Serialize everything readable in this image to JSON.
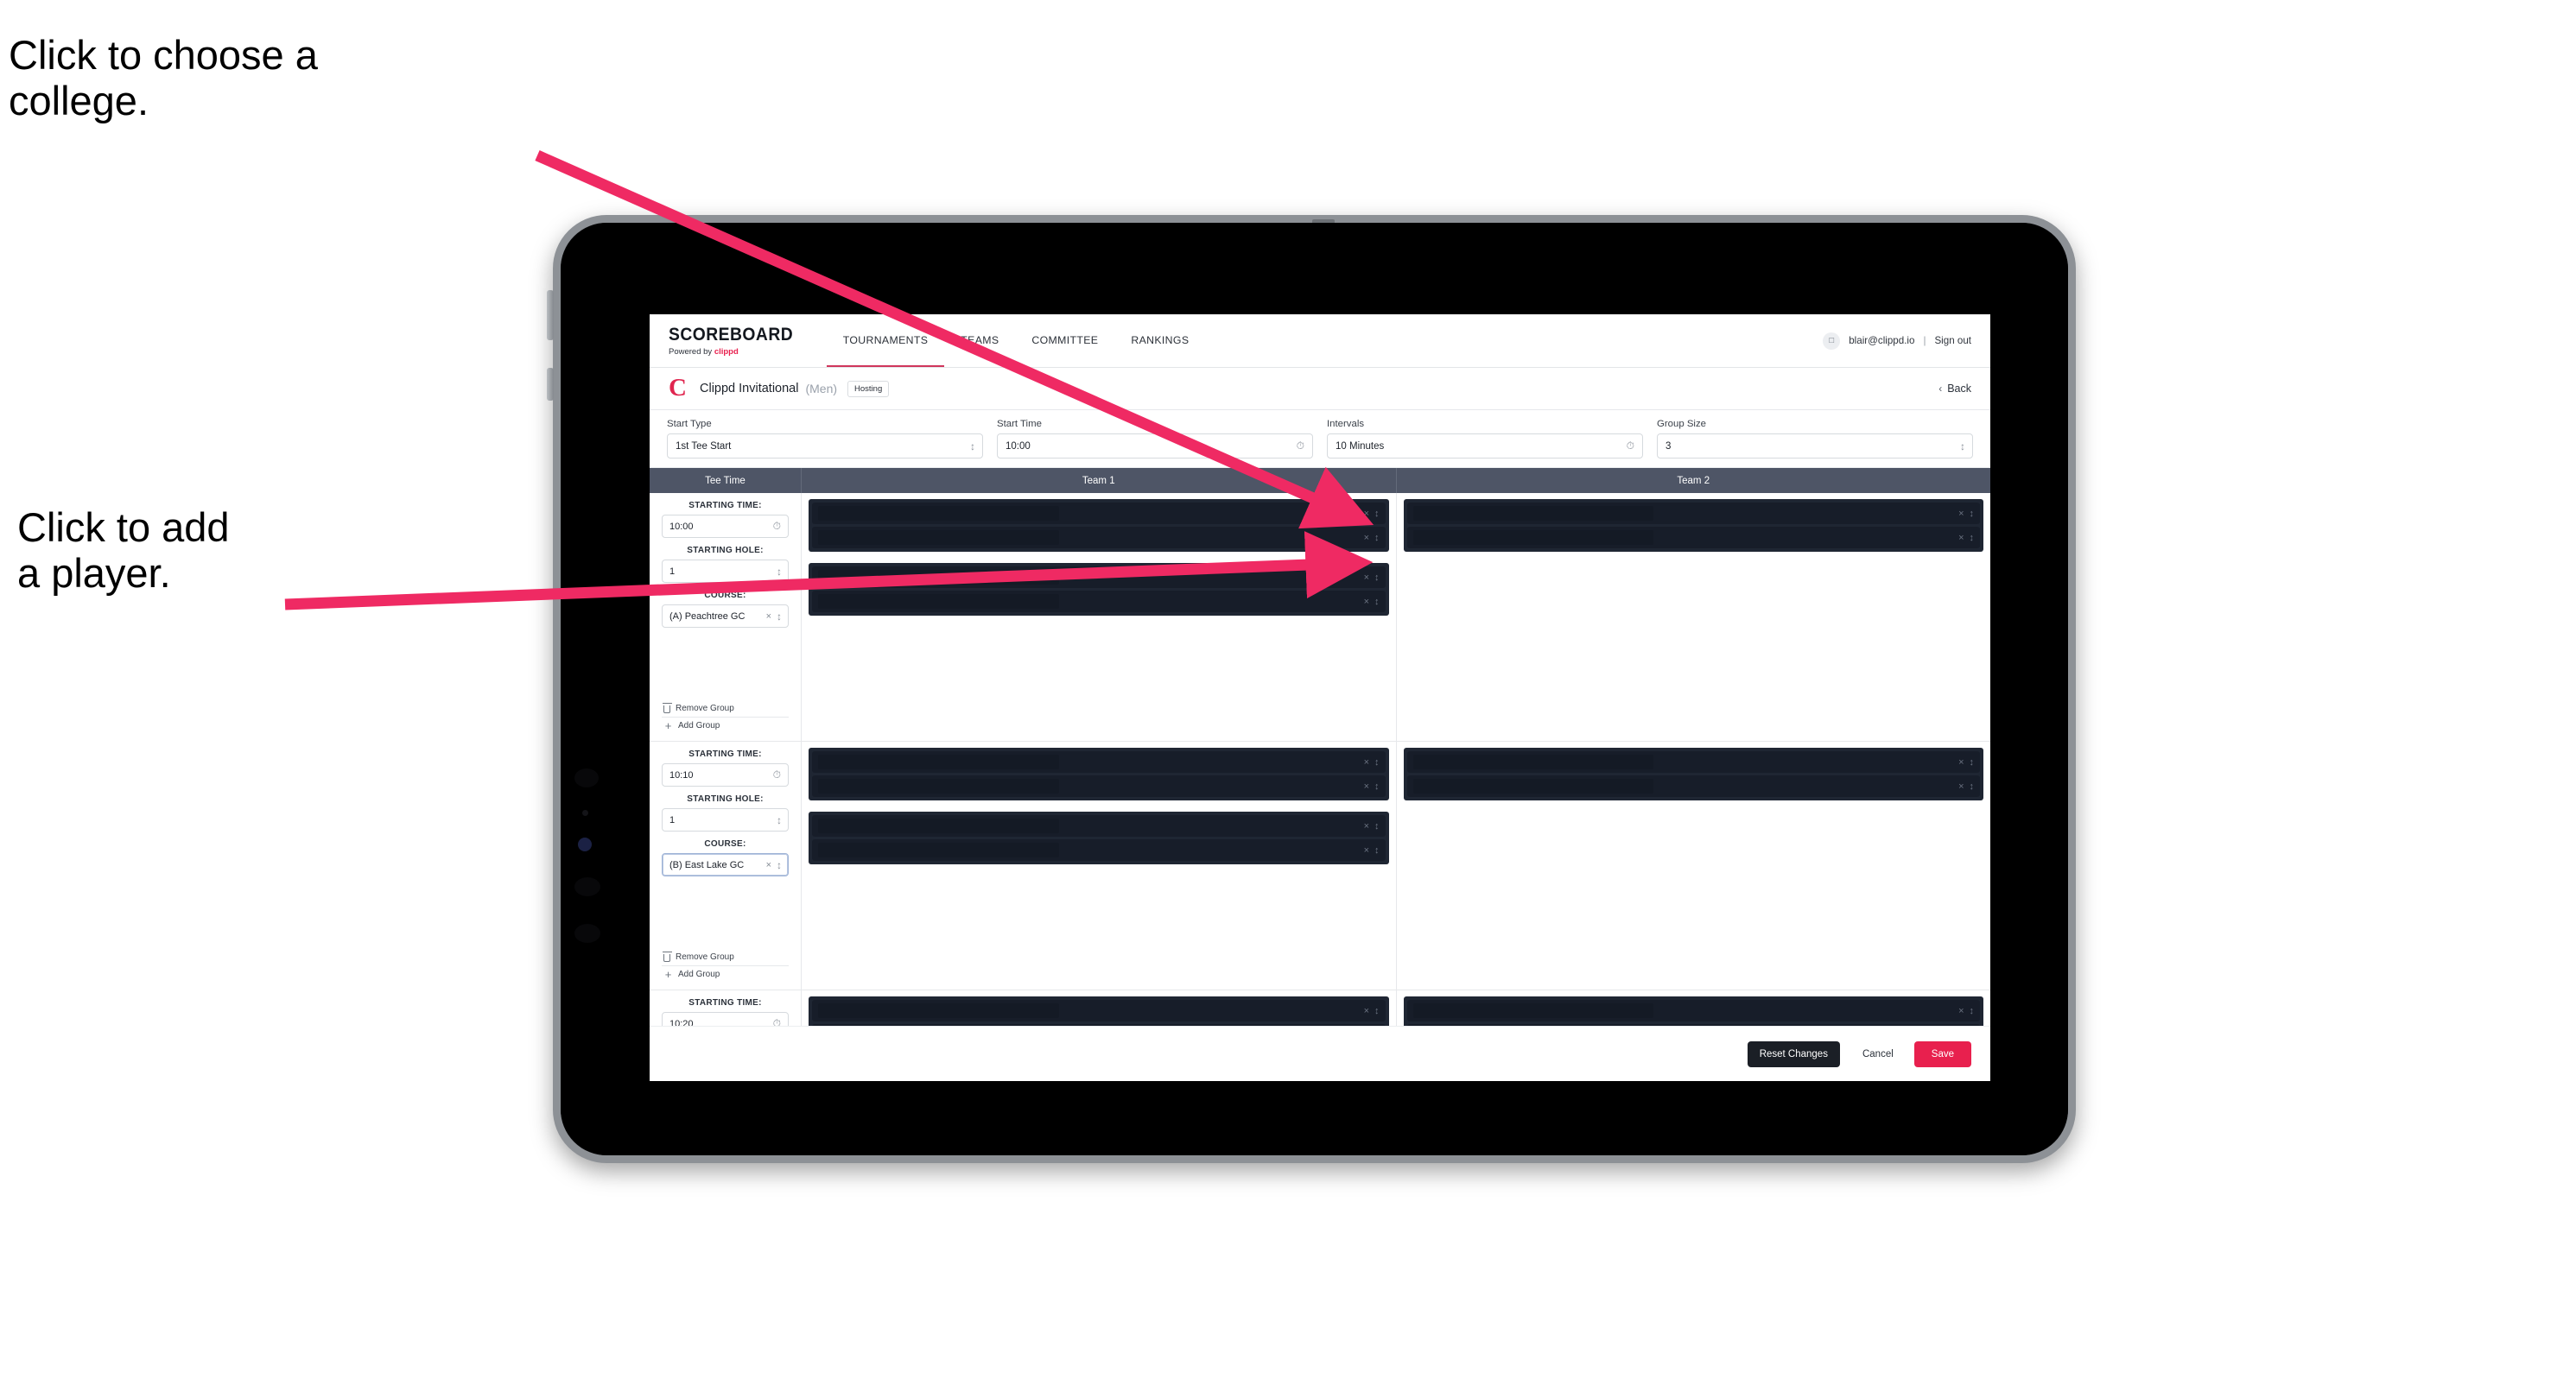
{
  "annotations": {
    "choose_college": "Click to choose a\ncollege.",
    "add_player": "Click to add\na player."
  },
  "colors": {
    "accent_pink": "#e8204e",
    "arrow_pink": "#ef2a63",
    "header_slate": "#4e5566",
    "panel_dark": "#1f2633",
    "slot_dark": "#171d29"
  },
  "topnav": {
    "brand_word": "SCOREBOARD",
    "brand_sub_prefix": "Powered by ",
    "brand_sub_name": "clippd",
    "items": [
      {
        "label": "TOURNAMENTS",
        "active": true
      },
      {
        "label": "TEAMS",
        "active": false
      },
      {
        "label": "COMMITTEE",
        "active": false
      },
      {
        "label": "RANKINGS",
        "active": false
      }
    ],
    "user_email": "blair@clippd.io",
    "divider": "|",
    "sign_out": "Sign out"
  },
  "tournament_bar": {
    "logo_letter": "C",
    "name": "Clippd Invitational",
    "gender": "(Men)",
    "badge": "Hosting",
    "back_chevron": "‹",
    "back_label": "Back"
  },
  "controls": [
    {
      "label": "Start Type",
      "value": "1st Tee Start",
      "adornment": "stepper"
    },
    {
      "label": "Start Time",
      "value": "10:00",
      "adornment": "clock"
    },
    {
      "label": "Intervals",
      "value": "10 Minutes",
      "adornment": "clock"
    },
    {
      "label": "Group Size",
      "value": "3",
      "adornment": "stepper"
    }
  ],
  "table": {
    "headers": [
      "Tee Time",
      "Team 1",
      "Team 2"
    ],
    "field_labels": {
      "starting_time": "STARTING TIME:",
      "starting_hole": "STARTING HOLE:",
      "course": "COURSE:"
    },
    "group_actions": {
      "remove": "Remove Group",
      "add": "Add Group"
    },
    "rows": [
      {
        "starting_time": "10:00",
        "starting_hole": "1",
        "course": "(A) Peachtree GC",
        "course_focused": false,
        "team1_panels": [
          2,
          2
        ],
        "team2_panels": [
          2
        ]
      },
      {
        "starting_time": "10:10",
        "starting_hole": "1",
        "course": "(B) East Lake GC",
        "course_focused": true,
        "team1_panels": [
          2,
          2
        ],
        "team2_panels": [
          2
        ]
      },
      {
        "starting_time": "10:20",
        "starting_hole": "",
        "course": "",
        "course_focused": false,
        "team1_panels": [
          2
        ],
        "team2_panels": [
          2
        ],
        "partial": true
      }
    ],
    "slot_icons": {
      "clear": "×",
      "stepper": "⌃⌄"
    }
  },
  "footer": {
    "reset": "Reset Changes",
    "cancel": "Cancel",
    "save": "Save"
  }
}
